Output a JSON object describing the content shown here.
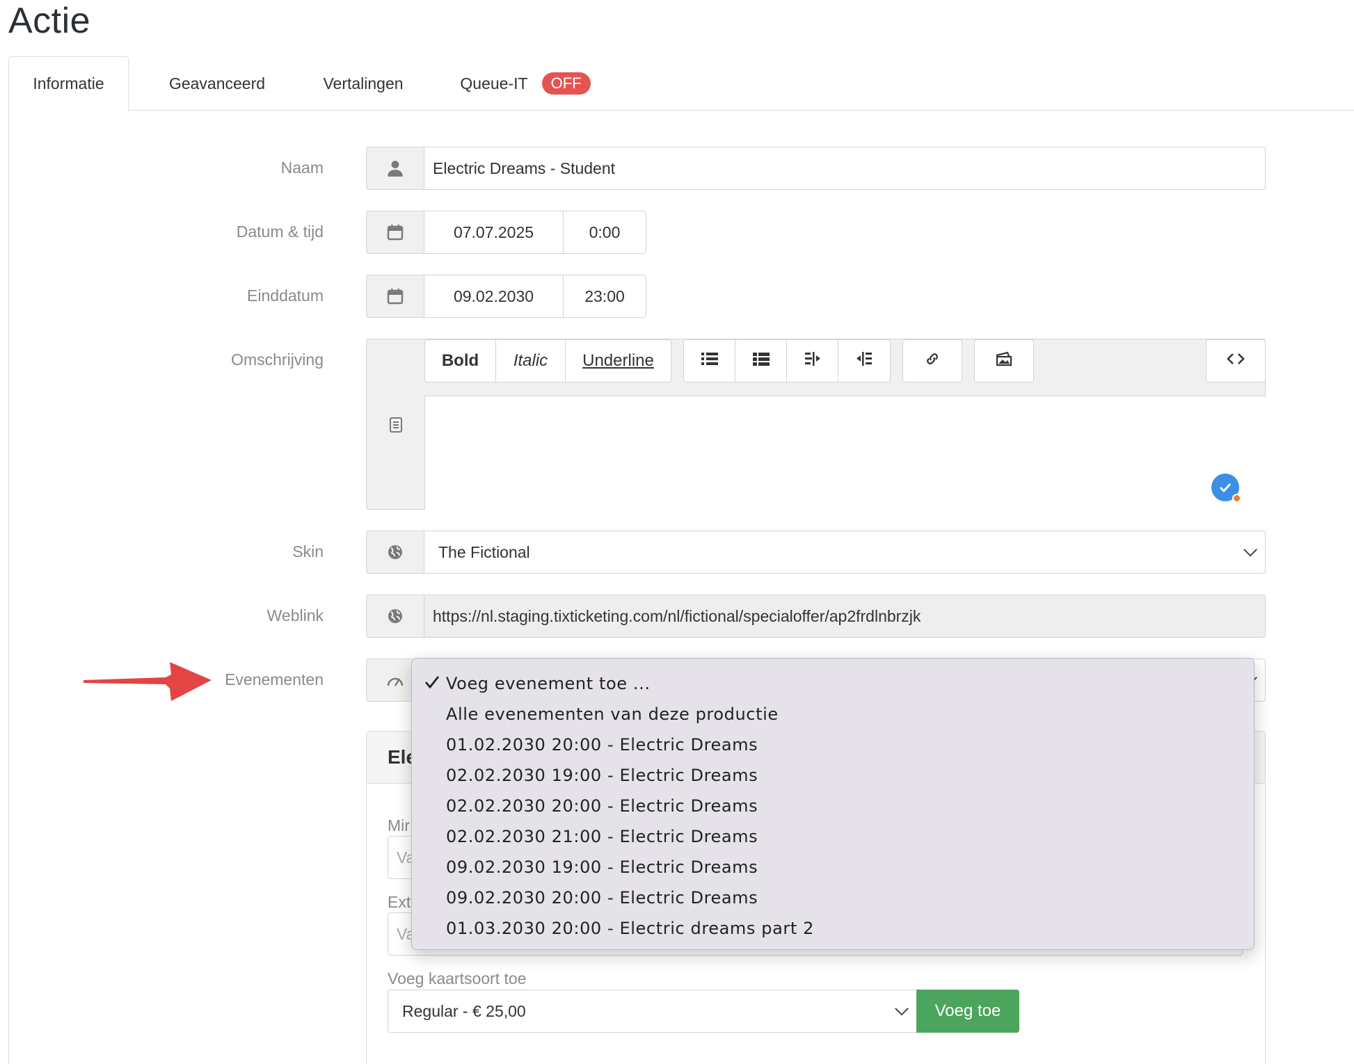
{
  "page": {
    "title": "Actie"
  },
  "tabs": [
    {
      "label": "Informatie",
      "active": true
    },
    {
      "label": "Geavanceerd"
    },
    {
      "label": "Vertalingen"
    },
    {
      "label": "Queue-IT",
      "badge": "OFF"
    }
  ],
  "form": {
    "naam": {
      "label": "Naam",
      "value": "Electric Dreams - Student",
      "icon": "user-icon"
    },
    "datum": {
      "label": "Datum & tijd",
      "date": "07.07.2025",
      "time": "0:00",
      "icon": "calendar-icon"
    },
    "einddatum": {
      "label": "Einddatum",
      "date": "09.02.2030",
      "time": "23:00",
      "icon": "calendar-icon"
    },
    "omschrijving": {
      "label": "Omschrijving",
      "icon": "document-icon",
      "toolbar": {
        "bold": "Bold",
        "italic": "Italic",
        "underline": "Underline"
      }
    },
    "skin": {
      "label": "Skin",
      "value": "The Fictional",
      "icon": "globe-icon"
    },
    "weblink": {
      "label": "Weblink",
      "value": "https://nl.staging.tixticketing.com/nl/fictional/specialoffer/ap2frdlnbrzjk",
      "icon": "globe-icon"
    },
    "evenementen": {
      "label": "Evenementen",
      "icon": "dashboard-icon"
    }
  },
  "dropdown": {
    "selected_index": 0,
    "options": [
      "Voeg evenement toe ...",
      "Alle evenementen van deze productie",
      "01.02.2030 20:00 - Electric Dreams",
      "02.02.2030 19:00 - Electric Dreams",
      "02.02.2030 20:00 - Electric Dreams",
      "02.02.2030 21:00 - Electric Dreams",
      "09.02.2030 19:00 - Electric Dreams",
      "09.02.2030 20:00 - Electric Dreams",
      "01.03.2030 20:00 - Electric dreams part 2"
    ]
  },
  "event_panel": {
    "title_partial": "Ele",
    "min_label_partial": "Mir",
    "min_placeholder_partial": "Va",
    "extra_label_partial": "Ext",
    "extra_placeholder_partial": "Va",
    "add_ticket_label": "Voeg kaartsoort toe",
    "ticket_select_value": "Regular - € 25,00",
    "add_button": "Voeg toe"
  },
  "colors": {
    "badge_off": "#e55353",
    "add_button": "#4ca55c",
    "annotation_arrow": "#e34444",
    "grammar_icon": "#3b8fe6"
  }
}
